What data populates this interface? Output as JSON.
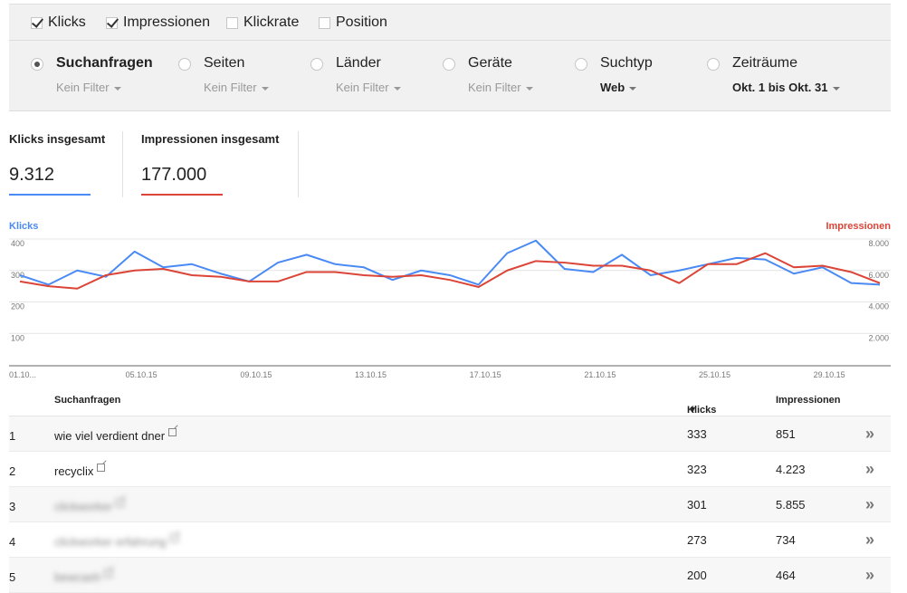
{
  "metrics_toggle": [
    {
      "label": "Klicks",
      "checked": true
    },
    {
      "label": "Impressionen",
      "checked": true
    },
    {
      "label": "Klickrate",
      "checked": false
    },
    {
      "label": "Position",
      "checked": false
    }
  ],
  "group_by": [
    {
      "label": "Suchanfragen",
      "sub": "Kein Filter",
      "selected": true
    },
    {
      "label": "Seiten",
      "sub": "Kein Filter",
      "selected": false
    },
    {
      "label": "Länder",
      "sub": "Kein Filter",
      "selected": false
    },
    {
      "label": "Geräte",
      "sub": "Kein Filter",
      "selected": false
    },
    {
      "label": "Suchtyp",
      "sub": "Web",
      "selected": false
    },
    {
      "label": "Zeiträume",
      "sub": "Okt. 1 bis Okt. 31",
      "selected": false
    }
  ],
  "totals": {
    "clicks_label": "Klicks insgesamt",
    "clicks_value": "9.312",
    "impressions_label": "Impressionen insgesamt",
    "impressions_value": "177.000"
  },
  "colors": {
    "clicks": "#4a8af4",
    "impressions": "#db4437"
  },
  "chart_data": {
    "type": "line",
    "left_axis_label": "Klicks",
    "right_axis_label": "Impressionen",
    "left_ticks": [
      "400",
      "300",
      "200",
      "100"
    ],
    "left_tick_values": [
      400,
      300,
      200,
      100
    ],
    "right_ticks": [
      "8.000",
      "6.000",
      "4.000",
      "2.000"
    ],
    "right_tick_values": [
      8000,
      6000,
      4000,
      2000
    ],
    "ylim_left": [
      0,
      400
    ],
    "ylim_right": [
      0,
      8000
    ],
    "x_tick_labels": [
      "01.10...",
      "05.10.15",
      "09.10.15",
      "13.10.15",
      "17.10.15",
      "21.10.15",
      "25.10.15",
      "29.10.15"
    ],
    "x_tick_days": [
      1,
      5,
      9,
      13,
      17,
      21,
      25,
      29
    ],
    "x": [
      1,
      2,
      3,
      4,
      5,
      6,
      7,
      8,
      9,
      10,
      11,
      12,
      13,
      14,
      15,
      16,
      17,
      18,
      19,
      20,
      21,
      22,
      23,
      24,
      25,
      26,
      27,
      28,
      29,
      30,
      31
    ],
    "series": [
      {
        "name": "Klicks",
        "axis": "left",
        "values": [
          285,
          255,
          300,
          280,
          360,
          310,
          320,
          290,
          265,
          325,
          350,
          320,
          310,
          270,
          300,
          285,
          255,
          355,
          395,
          305,
          295,
          350,
          285,
          300,
          320,
          340,
          335,
          290,
          310,
          260,
          255
        ]
      },
      {
        "name": "Impressionen",
        "axis": "right",
        "values": [
          5300,
          5000,
          4850,
          5700,
          6000,
          6100,
          5700,
          5600,
          5300,
          5300,
          5900,
          5900,
          5700,
          5600,
          5700,
          5400,
          4950,
          6000,
          6600,
          6500,
          6300,
          6300,
          6000,
          5200,
          6400,
          6400,
          7100,
          6200,
          6300,
          5900,
          5200
        ]
      }
    ],
    "grid": true,
    "legend": "top-left and top-right"
  },
  "table": {
    "headers": {
      "query": "Suchanfragen",
      "clicks": "Klicks",
      "impressions": "Impressionen"
    },
    "rows": [
      {
        "idx": "1",
        "query": "wie viel verdient dner",
        "clicks": "333",
        "impressions": "851",
        "blurred": false
      },
      {
        "idx": "2",
        "query": "recyclix",
        "clicks": "323",
        "impressions": "4.223",
        "blurred": false
      },
      {
        "idx": "3",
        "query": "clickworker",
        "clicks": "301",
        "impressions": "5.855",
        "blurred": true
      },
      {
        "idx": "4",
        "query": "clickworker erfahrung",
        "clicks": "273",
        "impressions": "734",
        "blurred": true
      },
      {
        "idx": "5",
        "query": "bewcash",
        "clicks": "200",
        "impressions": "464",
        "blurred": true
      }
    ],
    "more_glyph": "»"
  }
}
